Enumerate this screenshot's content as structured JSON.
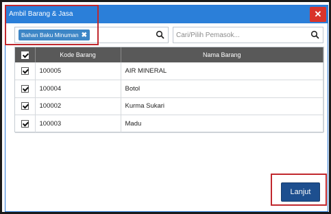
{
  "window": {
    "title": "Ambil Barang & Jasa",
    "close_label": "✕"
  },
  "filter": {
    "tag_label": "Bahan Baku Minuman",
    "tag_remove": "✖"
  },
  "supplier": {
    "placeholder": "Cari/Pilih Pemasok..."
  },
  "table": {
    "columns": [
      "Kode Barang",
      "Nama Barang"
    ],
    "rows": [
      {
        "kode": "100005",
        "nama": "AIR MINERAL"
      },
      {
        "kode": "100004",
        "nama": "Botol"
      },
      {
        "kode": "100002",
        "nama": "Kurma Sukari"
      },
      {
        "kode": "100003",
        "nama": "Madu"
      }
    ]
  },
  "actions": {
    "next_label": "Lanjut"
  },
  "colors": {
    "titlebar": "#2b7fd9",
    "close": "#d9342b",
    "highlight": "#c0272d",
    "primary_button": "#1d4f8f",
    "table_header": "#595959"
  }
}
